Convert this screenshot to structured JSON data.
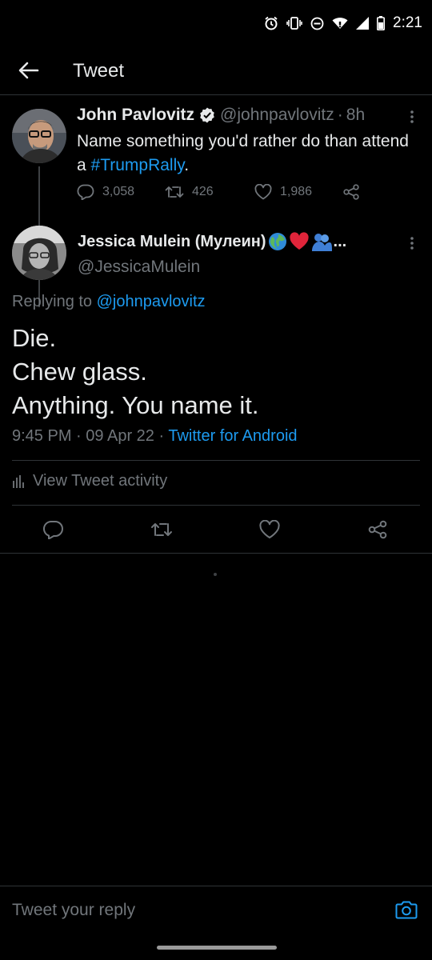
{
  "status_bar": {
    "time": "2:21"
  },
  "app_bar": {
    "title": "Tweet"
  },
  "parent_tweet": {
    "author_name": "John Pavlovitz",
    "handle": "@johnpavlovitz",
    "separator": "·",
    "age": "8h",
    "text_before": "Name something you'd rather do than attend a ",
    "hashtag": "#TrumpRally",
    "text_after": ".",
    "replies": "3,058",
    "retweets": "426",
    "likes": "1,986"
  },
  "reply_tweet": {
    "author_name": "Jessica Mulein (Мулеин)",
    "name_truncation": "...",
    "handle": "@JessicaMulein",
    "replying_prefix": "Replying to ",
    "replying_mention": "@johnpavlovitz",
    "body_lines": [
      "Die.",
      "Chew glass.",
      "Anything. You name it."
    ],
    "time": "9:45 PM",
    "date": "09 Apr 22",
    "separator": "·",
    "source": "Twitter for Android"
  },
  "activity": {
    "label": "View Tweet activity"
  },
  "compose": {
    "placeholder": "Tweet your reply"
  },
  "colors": {
    "accent": "#1d9bf0",
    "muted": "#71767b",
    "text": "#e7e9ea",
    "background": "#000000",
    "divider": "#2f3336",
    "heart": "#e0245e"
  }
}
